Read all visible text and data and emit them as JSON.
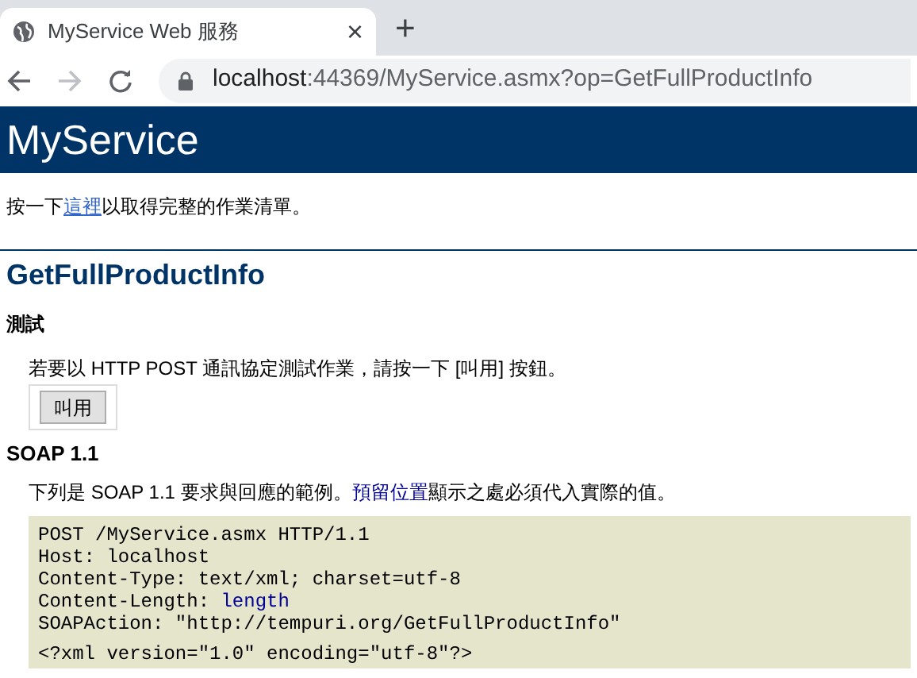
{
  "browser": {
    "tab_title": "MyService Web 服務",
    "tab_close": "×",
    "new_tab": "+",
    "address": {
      "host": "localhost",
      "rest": ":44369/MyService.asmx?op=GetFullProductInfo"
    }
  },
  "header": {
    "title": "MyService"
  },
  "intro": [
    {
      "kind": "text",
      "text": "按一下"
    },
    {
      "kind": "link",
      "text": "這裡"
    },
    {
      "kind": "text",
      "text": "以取得完整的作業清單。"
    }
  ],
  "operation": {
    "title": "GetFullProductInfo",
    "test": {
      "heading": "測試",
      "text": "若要以 HTTP POST 通訊協定測試作業，請按一下 [叫用] 按鈕。",
      "button": "叫用"
    },
    "soap": {
      "heading": "SOAP 1.1",
      "text": [
        {
          "kind": "text",
          "text": "下列是 SOAP 1.1 要求與回應的範例。"
        },
        {
          "kind": "placeholder",
          "text": "預留位置"
        },
        {
          "kind": "text",
          "text": "顯示之處必須代入實際的值。"
        }
      ],
      "code": [
        [
          {
            "kind": "text",
            "text": "POST /MyService.asmx HTTP/1.1"
          }
        ],
        [
          {
            "kind": "text",
            "text": "Host: localhost"
          }
        ],
        [
          {
            "kind": "text",
            "text": "Content-Type: text/xml; charset=utf-8"
          }
        ],
        [
          {
            "kind": "text",
            "text": "Content-Length: "
          },
          {
            "kind": "placeholder",
            "text": "length"
          }
        ],
        [
          {
            "kind": "text",
            "text": "SOAPAction: \"http://tempuri.org/GetFullProductInfo\""
          }
        ],
        [
          {
            "kind": "text",
            "text": "<?xml version=\"1.0\" encoding=\"utf-8\"?>"
          }
        ]
      ]
    }
  }
}
